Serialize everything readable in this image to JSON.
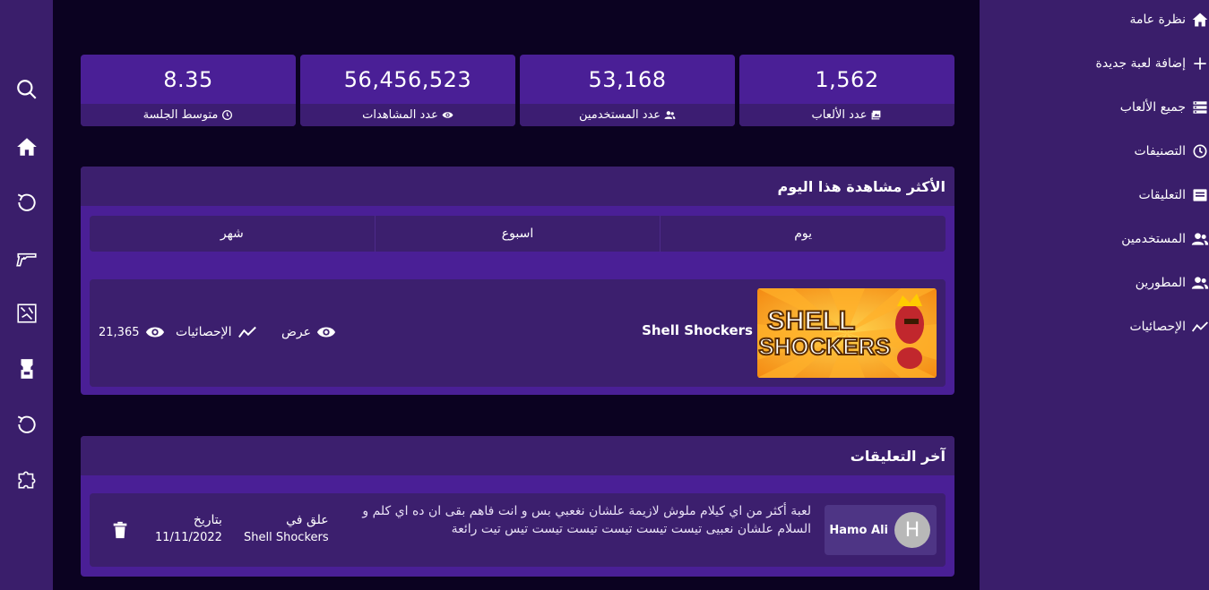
{
  "colors": {
    "rail_bg": "#3a1e6b",
    "page_bg": "#0b0221",
    "card_bg": "#4a1f96",
    "card_footer": "#3c1d72",
    "row_bg": "#3c1f6e",
    "accent_orange": "#f7941d"
  },
  "left_rail": {
    "icons": [
      "search-icon",
      "home-icon",
      "refresh-icon",
      "gun-icon",
      "map-icon",
      "arcade-icon",
      "history-icon",
      "puzzle-icon"
    ]
  },
  "sidebar": {
    "items": [
      {
        "label": "نظرة عامة",
        "icon": "home-icon"
      },
      {
        "label": "إضافة لعبة جديدة",
        "icon": "plus-icon"
      },
      {
        "label": "جميع الألعاب",
        "icon": "list-icon"
      },
      {
        "label": "التصنيفات",
        "icon": "clock-icon"
      },
      {
        "label": "التعليقات",
        "icon": "comments-icon"
      },
      {
        "label": "المستخدمين",
        "icon": "users-icon"
      },
      {
        "label": "المطورين",
        "icon": "developers-icon"
      },
      {
        "label": "الإحصائيات",
        "icon": "stats-icon"
      }
    ]
  },
  "stats": [
    {
      "value": "1,562",
      "label": "عدد الألعاب",
      "icon": "image-icon"
    },
    {
      "value": "53,168",
      "label": "عدد المستخدمين",
      "icon": "users-icon"
    },
    {
      "value": "56,456,523",
      "label": "عدد المشاهدات",
      "icon": "eye-icon"
    },
    {
      "value": "8.35",
      "label": "متوسط الجلسة",
      "icon": "clock-icon"
    }
  ],
  "most_viewed": {
    "title": "الأكثر مشاهدة هذا اليوم",
    "tabs": [
      "يوم",
      "اسبوع",
      "شهر"
    ],
    "game": {
      "name": "Shell Shockers",
      "thumb_text_1": "SHELL",
      "thumb_text_2": "SHOCKERS",
      "view_label": "عرض",
      "stats_label": "الإحصائيات",
      "views": "21,365"
    }
  },
  "latest_comments": {
    "title": "آخر التعليقات",
    "comment": {
      "user": "Hamo Ali",
      "avatar_letter": "H",
      "text": "لعبة أكثر من اي كيلام ملوش لازيمة علشان نغعبي بس و انت فاهم بقى ان ده اي كلم و السلام علشان نعبيى تيست تيست تيست تيست تيست تيس تيت رائعة",
      "commented_on_label": "علق في",
      "commented_on_value": "Shell Shockers",
      "date_label": "بتاريخ",
      "date_value": "11/11/2022"
    }
  }
}
